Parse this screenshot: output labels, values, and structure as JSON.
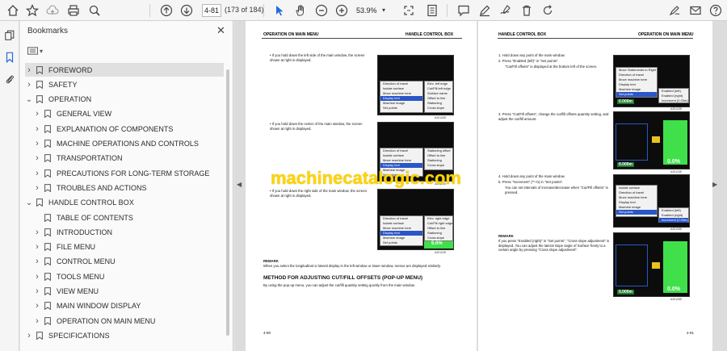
{
  "toolbar": {
    "page_current": "4-81",
    "page_count": "(173 of 184)",
    "zoom": "53.9%"
  },
  "panel": {
    "title": "Bookmarks"
  },
  "bookmarks": [
    {
      "label": "FOREWORD",
      "level": 0,
      "expanded": false,
      "selected": true
    },
    {
      "label": "SAFETY",
      "level": 0,
      "expanded": false
    },
    {
      "label": "OPERATION",
      "level": 0,
      "expanded": true
    },
    {
      "label": "GENERAL VIEW",
      "level": 1,
      "expanded": false
    },
    {
      "label": "EXPLANATION OF COMPONENTS",
      "level": 1,
      "expanded": false
    },
    {
      "label": "MACHINE OPERATIONS AND CONTROLS",
      "level": 1,
      "expanded": false
    },
    {
      "label": "TRANSPORTATION",
      "level": 1,
      "expanded": false
    },
    {
      "label": "PRECAUTIONS FOR LONG-TERM STORAGE",
      "level": 1,
      "expanded": false
    },
    {
      "label": "TROUBLES AND ACTIONS",
      "level": 1,
      "expanded": false
    },
    {
      "label": "HANDLE CONTROL BOX",
      "level": 0,
      "expanded": true
    },
    {
      "label": "TABLE OF CONTENTS",
      "level": 1,
      "leaf": true
    },
    {
      "label": "INTRODUCTION",
      "level": 1,
      "expanded": false
    },
    {
      "label": "FILE MENU",
      "level": 1,
      "expanded": false
    },
    {
      "label": "CONTROL MENU",
      "level": 1,
      "expanded": false
    },
    {
      "label": "TOOLS MENU",
      "level": 1,
      "expanded": false
    },
    {
      "label": "VIEW MENU",
      "level": 1,
      "expanded": false
    },
    {
      "label": "MAIN WINDOW DISPLAY",
      "level": 1,
      "expanded": false
    },
    {
      "label": "OPERATION ON MAIN MENU",
      "level": 1,
      "expanded": false
    },
    {
      "label": "SPECIFICATIONS",
      "level": 0,
      "expanded": false
    }
  ],
  "left_page": {
    "header_left": "OPERATION ON MAIN MENU",
    "header_right": "HANDLE CONTROL BOX",
    "p1": "• If you hold down the left side of the main window, the screen shown at right is displayed.",
    "p2": "• If you hold down the center of the main window, the screen shown at right is displayed.",
    "p3": "• If you hold down the right side of the main window, the screen shown at right is displayed.",
    "remark": "REMARK",
    "remark_text": "When you select the longitudinal or lateral display in the left window or lower window, menus are displayed similarly.",
    "heading": "METHOD FOR ADJUSTING CUT/FILL OFFSETS (POP-UP MENU)",
    "body": "By using the pop-up menu, you can adjust the cut/fill quantity setting quickly from the main window.",
    "footer": "4-80",
    "menu1": [
      "Direction of travel",
      "Isolate surface",
      "Move machine here",
      "Display text",
      "Machine image",
      "Set points"
    ],
    "menu1b": [
      "Elev. left edge",
      "Cut/Fill left edge",
      "Surface name",
      "Offset to line",
      "Stationing",
      "Cross slope"
    ],
    "menu2b": [
      "Stationing offset",
      "Offset to line",
      "Stationing",
      "Cross slope"
    ],
    "menu3b": [
      "Elev. right edge",
      "Cut/Fill right edge",
      "Offset to line",
      "Stationing",
      "Cross slope"
    ],
    "fig1": "A20120E",
    "fig2": "A20121E",
    "fig3": "A20122E",
    "val3": "5.0%"
  },
  "right_page": {
    "header_left": "HANDLE CONTROL BOX",
    "header_right": "OPERATION ON MAIN MENU",
    "s1": "1. Hold down any point of the main window.",
    "s2": "2. Press \"Enabled (left)\" in \"Set points\".",
    "s2b": "\"Cut/Fill offsets\" is displayed at the bottom left of the screen.",
    "s3": "3. Press \"Cut/Fill offsets\", change the cut/fill offsets quantity setting, and adjust the cut/fill amount.",
    "s4": "4. Hold down any point of the main window.",
    "s5": "5. Press \"Increment\" (** m) in \"Set points\".",
    "s5b": "You can set intervals of increase/decrease when \"Cut/Fill offsets\" is pressed.",
    "remark": "REMARK",
    "remark_text": "If you press \"Enabled (right)\" in \"Set points\", \"Cross slope adjustment\" is displayed. You can adjust the lateral slope angle of Surface freely to a certain angle by pressing \"Cross slope adjustment\".",
    "footer": "4-81",
    "menuA": [
      "Move Statements to Right",
      "Direction of travel",
      "Move machine here",
      "Display text",
      "Machine image",
      "Set points"
    ],
    "menuA_side": [
      "Enabled (left)",
      "Enabled (right)",
      "Increment (0.03m)"
    ],
    "menuB": [
      "Isolate surface",
      "Direction of travel",
      "Move machine here",
      "Display text",
      "Machine image",
      "Set points"
    ],
    "menuB_side": [
      "Enabled (left)",
      "Enabled (right)",
      "Increment (0.03m)"
    ],
    "figA": "A20123E",
    "figB": "A20124E",
    "figC": "A20125E",
    "figD": "A20126E",
    "valA": "0.000m",
    "valB": "0.0%",
    "valC": "0.000m",
    "valD": "0.0%"
  },
  "watermark": "machinecatalogic.com"
}
